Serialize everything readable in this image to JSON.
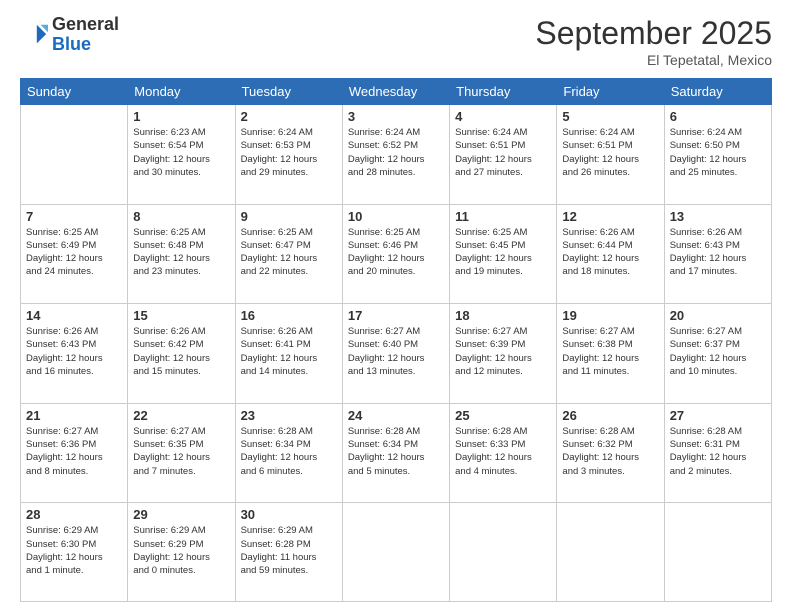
{
  "header": {
    "logo_line1": "General",
    "logo_line2": "Blue",
    "month": "September 2025",
    "location": "El Tepetatal, Mexico"
  },
  "weekdays": [
    "Sunday",
    "Monday",
    "Tuesday",
    "Wednesday",
    "Thursday",
    "Friday",
    "Saturday"
  ],
  "weeks": [
    [
      {
        "day": "",
        "content": ""
      },
      {
        "day": "1",
        "content": "Sunrise: 6:23 AM\nSunset: 6:54 PM\nDaylight: 12 hours\nand 30 minutes."
      },
      {
        "day": "2",
        "content": "Sunrise: 6:24 AM\nSunset: 6:53 PM\nDaylight: 12 hours\nand 29 minutes."
      },
      {
        "day": "3",
        "content": "Sunrise: 6:24 AM\nSunset: 6:52 PM\nDaylight: 12 hours\nand 28 minutes."
      },
      {
        "day": "4",
        "content": "Sunrise: 6:24 AM\nSunset: 6:51 PM\nDaylight: 12 hours\nand 27 minutes."
      },
      {
        "day": "5",
        "content": "Sunrise: 6:24 AM\nSunset: 6:51 PM\nDaylight: 12 hours\nand 26 minutes."
      },
      {
        "day": "6",
        "content": "Sunrise: 6:24 AM\nSunset: 6:50 PM\nDaylight: 12 hours\nand 25 minutes."
      }
    ],
    [
      {
        "day": "7",
        "content": "Sunrise: 6:25 AM\nSunset: 6:49 PM\nDaylight: 12 hours\nand 24 minutes."
      },
      {
        "day": "8",
        "content": "Sunrise: 6:25 AM\nSunset: 6:48 PM\nDaylight: 12 hours\nand 23 minutes."
      },
      {
        "day": "9",
        "content": "Sunrise: 6:25 AM\nSunset: 6:47 PM\nDaylight: 12 hours\nand 22 minutes."
      },
      {
        "day": "10",
        "content": "Sunrise: 6:25 AM\nSunset: 6:46 PM\nDaylight: 12 hours\nand 20 minutes."
      },
      {
        "day": "11",
        "content": "Sunrise: 6:25 AM\nSunset: 6:45 PM\nDaylight: 12 hours\nand 19 minutes."
      },
      {
        "day": "12",
        "content": "Sunrise: 6:26 AM\nSunset: 6:44 PM\nDaylight: 12 hours\nand 18 minutes."
      },
      {
        "day": "13",
        "content": "Sunrise: 6:26 AM\nSunset: 6:43 PM\nDaylight: 12 hours\nand 17 minutes."
      }
    ],
    [
      {
        "day": "14",
        "content": "Sunrise: 6:26 AM\nSunset: 6:43 PM\nDaylight: 12 hours\nand 16 minutes."
      },
      {
        "day": "15",
        "content": "Sunrise: 6:26 AM\nSunset: 6:42 PM\nDaylight: 12 hours\nand 15 minutes."
      },
      {
        "day": "16",
        "content": "Sunrise: 6:26 AM\nSunset: 6:41 PM\nDaylight: 12 hours\nand 14 minutes."
      },
      {
        "day": "17",
        "content": "Sunrise: 6:27 AM\nSunset: 6:40 PM\nDaylight: 12 hours\nand 13 minutes."
      },
      {
        "day": "18",
        "content": "Sunrise: 6:27 AM\nSunset: 6:39 PM\nDaylight: 12 hours\nand 12 minutes."
      },
      {
        "day": "19",
        "content": "Sunrise: 6:27 AM\nSunset: 6:38 PM\nDaylight: 12 hours\nand 11 minutes."
      },
      {
        "day": "20",
        "content": "Sunrise: 6:27 AM\nSunset: 6:37 PM\nDaylight: 12 hours\nand 10 minutes."
      }
    ],
    [
      {
        "day": "21",
        "content": "Sunrise: 6:27 AM\nSunset: 6:36 PM\nDaylight: 12 hours\nand 8 minutes."
      },
      {
        "day": "22",
        "content": "Sunrise: 6:27 AM\nSunset: 6:35 PM\nDaylight: 12 hours\nand 7 minutes."
      },
      {
        "day": "23",
        "content": "Sunrise: 6:28 AM\nSunset: 6:34 PM\nDaylight: 12 hours\nand 6 minutes."
      },
      {
        "day": "24",
        "content": "Sunrise: 6:28 AM\nSunset: 6:34 PM\nDaylight: 12 hours\nand 5 minutes."
      },
      {
        "day": "25",
        "content": "Sunrise: 6:28 AM\nSunset: 6:33 PM\nDaylight: 12 hours\nand 4 minutes."
      },
      {
        "day": "26",
        "content": "Sunrise: 6:28 AM\nSunset: 6:32 PM\nDaylight: 12 hours\nand 3 minutes."
      },
      {
        "day": "27",
        "content": "Sunrise: 6:28 AM\nSunset: 6:31 PM\nDaylight: 12 hours\nand 2 minutes."
      }
    ],
    [
      {
        "day": "28",
        "content": "Sunrise: 6:29 AM\nSunset: 6:30 PM\nDaylight: 12 hours\nand 1 minute."
      },
      {
        "day": "29",
        "content": "Sunrise: 6:29 AM\nSunset: 6:29 PM\nDaylight: 12 hours\nand 0 minutes."
      },
      {
        "day": "30",
        "content": "Sunrise: 6:29 AM\nSunset: 6:28 PM\nDaylight: 11 hours\nand 59 minutes."
      },
      {
        "day": "",
        "content": ""
      },
      {
        "day": "",
        "content": ""
      },
      {
        "day": "",
        "content": ""
      },
      {
        "day": "",
        "content": ""
      }
    ]
  ]
}
